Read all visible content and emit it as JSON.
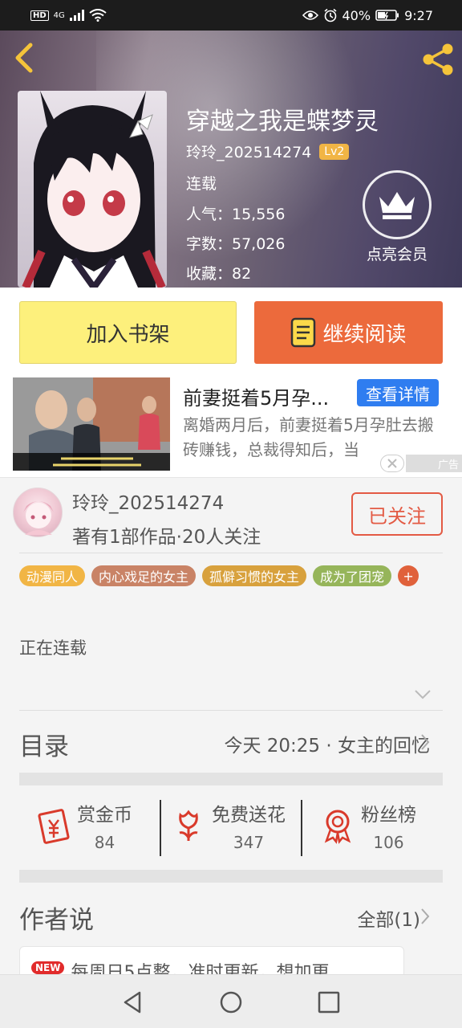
{
  "status_bar": {
    "hd": "HD",
    "network": "4G",
    "battery": "40%",
    "time": "9:27"
  },
  "book": {
    "title": "穿越之我是蝶梦灵",
    "author": "玲玲_202514274",
    "level": "Lv2",
    "status": "连载",
    "popularity": "人气：15,556",
    "word_count": "字数：57,026",
    "favorites": "收藏：82",
    "vip_label": "点亮会员"
  },
  "actions": {
    "add_shelf": "加入书架",
    "continue_read": "继续阅读"
  },
  "ad": {
    "title": "前妻挺着5月孕...",
    "detail_button": "查看详情",
    "description": "离婚两月后，前妻挺着5月孕肚去搬砖赚钱，总裁得知后，当",
    "ad_label": "广告"
  },
  "author_panel": {
    "name": "玲玲_202514274",
    "stats": "著有1部作品·20人关注",
    "follow_button": "已关注"
  },
  "tags": [
    {
      "label": "动漫同人",
      "color": "#f1b545"
    },
    {
      "label": "内心戏足的女主",
      "color": "#c98366"
    },
    {
      "label": "孤僻习惯的女主",
      "color": "#d8a13d"
    },
    {
      "label": "成为了团宠",
      "color": "#96b55a"
    }
  ],
  "tag_add": "+",
  "intro": "正在连载",
  "catalog": {
    "label": "目录",
    "latest": "今天 20:25 · 女主的回忆"
  },
  "stats": [
    {
      "label": "赏金币",
      "value": "84",
      "icon": "red-envelope-icon"
    },
    {
      "label": "免费送花",
      "value": "347",
      "icon": "flower-icon"
    },
    {
      "label": "粉丝榜",
      "value": "106",
      "icon": "medal-icon"
    }
  ],
  "author_says": {
    "label": "作者说",
    "all": "全部(1)",
    "badge": "NEW",
    "text": "每周日5点整，准时更新，想加更"
  },
  "colors": {
    "accent_orange": "#ec6a3c",
    "shelf_yellow": "#fdf07c",
    "follow_red": "#e35a44",
    "ad_blue": "#2f7df0"
  }
}
